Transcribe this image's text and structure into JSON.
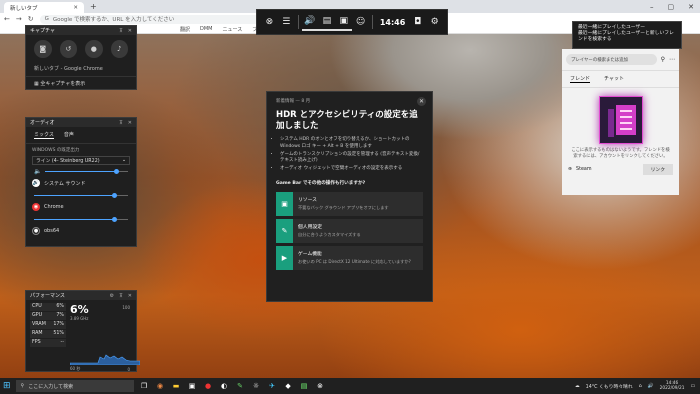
{
  "browser": {
    "tab_title": "新しいタブ",
    "address_placeholder": "Google で検索するか、URL を入力してください",
    "bookmarks": [
      "翻訳",
      "DMM",
      "ニュース",
      "ブログ"
    ]
  },
  "gamebar": {
    "clock": "14:46",
    "widgets": [
      "xbox-icon",
      "widget-menu-icon",
      "audio-icon",
      "performance-icon",
      "capture-monitor-icon",
      "xbox-social-icon"
    ]
  },
  "capture": {
    "title": "キャプチャ",
    "current_app": "新しいタブ - Google Chrome",
    "show_all": "全キャプチャを表示"
  },
  "audio": {
    "title": "オーディオ",
    "tabs": [
      "ミックス",
      "音声"
    ],
    "default_out_label": "WINDOWS の既定出力",
    "device": "ライン (4- Steinberg UR22)",
    "apps": [
      {
        "name": "システム サウンド",
        "level": 0.85
      },
      {
        "name": "Chrome",
        "level": 0.85
      },
      {
        "name": "obs64",
        "level": 0.85
      }
    ],
    "master_level": 0.85
  },
  "performance": {
    "title": "パフォーマンス",
    "metrics": [
      {
        "k": "CPU",
        "v": "6%"
      },
      {
        "k": "GPU",
        "v": "7%"
      },
      {
        "k": "VRAM",
        "v": "17%"
      },
      {
        "k": "RAM",
        "v": "51%"
      },
      {
        "k": "FPS",
        "v": "--"
      }
    ],
    "big": "6%",
    "freq": "3.89 GHz",
    "max": "100",
    "sec": "60 秒",
    "zero": "0"
  },
  "whatsnew": {
    "header": "新着情報 — 8 月",
    "title": "HDR とアクセシビリティの設定を追加しました",
    "bullets": [
      "システム HDR のオンとオフを切り替えるか、ショートカットの Windows ロゴ キー + Alt + B を使用します",
      "ゲームのトランスクリプションの設定を管理する (音声テキスト変換/テキスト読み上げ)",
      "オーディオ ウィジェットで空間オーディオの設定を表示する"
    ],
    "question": "Game Bar でその他の操作も行いますか?",
    "cards": [
      {
        "title": "リソース",
        "desc": "不要なバック グラウンド アプリをオフにします",
        "icon": "▣"
      },
      {
        "title": "個人用設定",
        "desc": "自分に合うようカスタマイズする",
        "icon": "✎"
      },
      {
        "title": "ゲーム機能",
        "desc": "お使いの PC は DirectX 12 Ultimate に対応していますか?",
        "icon": "▶"
      }
    ]
  },
  "social": {
    "notif_title": "最近一緒にプレイしたユーザー",
    "notif_body": "最近一緒にプレイしたユーザーと新しいフレンドを検索する",
    "search": "プレイヤーの検索または追加",
    "tabs": [
      "フレンド",
      "チャット"
    ],
    "empty_text": "ここに表示するものはないようです。フレンドを検索するには、アカウントをリンクしてください。",
    "steam": "Steam",
    "link_button": "リンク"
  },
  "taskbar": {
    "search": "ここに入力して検索",
    "weather": "14°C くもり時々晴れ",
    "time": "14:46",
    "date": "2022/09/21"
  }
}
